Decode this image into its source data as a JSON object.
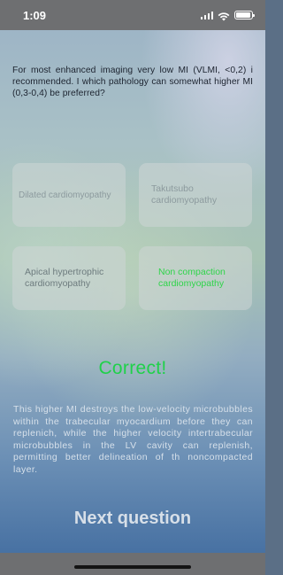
{
  "status_bar": {
    "time": "1:09",
    "icons": [
      "cellular-signal-icon",
      "wifi-icon",
      "battery-icon"
    ]
  },
  "question": {
    "text": "For most enhanced imaging very low MI (VLMI, <0,2) i recommended. I which pathology can somewhat higher MI (0,3-0,4) be preferred?"
  },
  "answers": [
    {
      "label": "Dilated cardiomyopathy",
      "state": "disabled"
    },
    {
      "label": "Takutsubo cardiomyopathy",
      "state": "disabled"
    },
    {
      "label": "Apical hypertrophic cardiomyopathy",
      "state": "disabled"
    },
    {
      "label": "Non compaction cardiomyopathy",
      "state": "correct"
    }
  ],
  "result": {
    "text": "Correct!",
    "color": "#1fd14a"
  },
  "explanation": {
    "text": "This higher MI destroys the low-velocity microbubbles within the trabecular myocardium before they can replenich, while the higher velocity intertrabecular microbubbles in the LV cavity can replenish, permitting better delineation of th noncompacted layer."
  },
  "next_button": {
    "label": "Next question"
  }
}
